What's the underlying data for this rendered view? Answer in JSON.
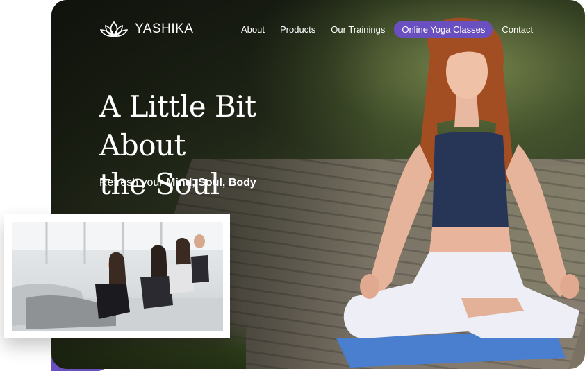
{
  "brand": {
    "name": "YASHIKA",
    "logo_icon": "lotus-icon"
  },
  "nav": {
    "items": [
      {
        "label": "About"
      },
      {
        "label": "Products"
      },
      {
        "label": "Our Trainings"
      },
      {
        "label": "Online Yoga Classes",
        "active": true
      },
      {
        "label": "Contact"
      }
    ]
  },
  "hero": {
    "headline_line1": "A Little Bit About",
    "headline_line2": "the Soul",
    "sub_prefix": "Refresh your",
    "sub_bold": "Mind, Soul, Body"
  },
  "colors": {
    "accent": "#6a4fc0",
    "text_light": "#ffffff"
  }
}
